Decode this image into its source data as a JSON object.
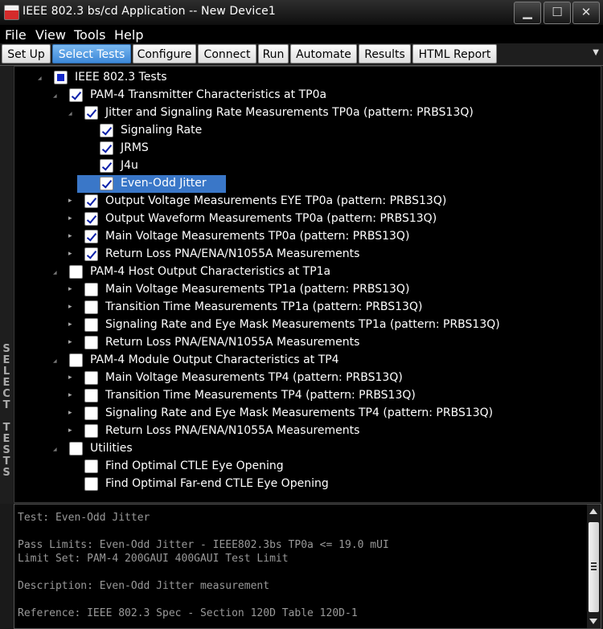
{
  "window": {
    "title": "IEEE 802.3 bs/cd Application -- New Device1",
    "minimize_glyph": "▁",
    "maximize_glyph": "☐",
    "close_glyph": "✕"
  },
  "menu": [
    "File",
    "View",
    "Tools",
    "Help"
  ],
  "tabs": [
    {
      "label": "Set Up",
      "active": false
    },
    {
      "label": "Select Tests",
      "active": true
    },
    {
      "label": "Configure",
      "active": false
    },
    {
      "label": "Connect",
      "active": false
    },
    {
      "label": "Run",
      "active": false
    },
    {
      "label": "Automate",
      "active": false
    },
    {
      "label": "Results",
      "active": false
    },
    {
      "label": "HTML Report",
      "active": false
    }
  ],
  "side_tab_label": "SELECT TESTS",
  "tree": [
    {
      "label": "IEEE 802.3 Tests",
      "state": "partial",
      "expander": "expanded"
    },
    {
      "label": "PAM-4 Transmitter Characteristics at TP0a",
      "state": "checked",
      "expander": "expanded"
    },
    {
      "label": "Jitter and Signaling Rate Measurements TP0a (pattern: PRBS13Q)",
      "state": "checked",
      "expander": "expanded"
    },
    {
      "label": "Signaling Rate",
      "state": "checked",
      "expander": "none"
    },
    {
      "label": "JRMS",
      "state": "checked",
      "expander": "none"
    },
    {
      "label": "J4u",
      "state": "checked",
      "expander": "none"
    },
    {
      "label": "Even-Odd Jitter",
      "state": "checked",
      "expander": "none",
      "selected": true
    },
    {
      "label": "Output Voltage Measurements EYE TP0a (pattern: PRBS13Q)",
      "state": "checked",
      "expander": "collapsed"
    },
    {
      "label": "Output Waveform Measurements TP0a (pattern: PRBS13Q)",
      "state": "checked",
      "expander": "collapsed"
    },
    {
      "label": "Main Voltage Measurements TP0a (pattern: PRBS13Q)",
      "state": "checked",
      "expander": "collapsed"
    },
    {
      "label": "Return Loss PNA/ENA/N1055A Measurements",
      "state": "checked",
      "expander": "collapsed"
    },
    {
      "label": "PAM-4 Host Output Characteristics at TP1a",
      "state": "unchecked",
      "expander": "expanded"
    },
    {
      "label": "Main Voltage Measurements TP1a (pattern: PRBS13Q)",
      "state": "unchecked",
      "expander": "collapsed"
    },
    {
      "label": "Transition Time Measurements TP1a (pattern: PRBS13Q)",
      "state": "unchecked",
      "expander": "collapsed"
    },
    {
      "label": "Signaling Rate and Eye Mask Measurements TP1a (pattern: PRBS13Q)",
      "state": "unchecked",
      "expander": "collapsed"
    },
    {
      "label": "Return Loss PNA/ENA/N1055A Measurements",
      "state": "unchecked",
      "expander": "collapsed"
    },
    {
      "label": "PAM-4 Module Output Characteristics at TP4",
      "state": "unchecked",
      "expander": "expanded"
    },
    {
      "label": "Main Voltage Measurements TP4 (pattern: PRBS13Q)",
      "state": "unchecked",
      "expander": "collapsed"
    },
    {
      "label": "Transition Time Measurements TP4 (pattern: PRBS13Q)",
      "state": "unchecked",
      "expander": "collapsed"
    },
    {
      "label": "Signaling Rate and Eye Mask Measurements TP4 (pattern: PRBS13Q)",
      "state": "unchecked",
      "expander": "collapsed"
    },
    {
      "label": "Return Loss PNA/ENA/N1055A Measurements",
      "state": "unchecked",
      "expander": "collapsed"
    },
    {
      "label": "Utilities",
      "state": "unchecked",
      "expander": "expanded"
    },
    {
      "label": "Find Optimal CTLE Eye Opening",
      "state": "unchecked",
      "expander": "none"
    },
    {
      "label": "Find Optimal Far-end CTLE Eye Opening",
      "state": "unchecked",
      "expander": "none"
    }
  ],
  "info": {
    "test": "Test: Even-Odd Jitter",
    "pass_limits": "Pass Limits: Even-Odd Jitter - IEEE802.3bs TP0a <= 19.0 mUI",
    "limit_set": "Limit Set: PAM-4 200GAUI 400GAUI Test Limit",
    "description": "Description: Even-Odd Jitter measurement",
    "reference": "Reference: IEEE 802.3 Spec - Section 120D Table 120D-1"
  },
  "colors": {
    "selection": "#3a77c8",
    "active_tab": "#4a90e2",
    "check": "#0a1fa8"
  }
}
